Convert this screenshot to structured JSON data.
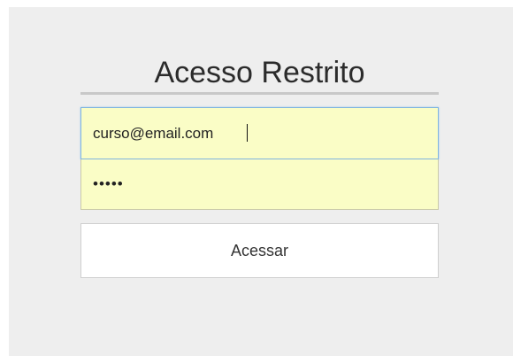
{
  "login": {
    "title": "Acesso Restrito",
    "email_value": "curso@email.com",
    "password_mask": "•••••",
    "submit_label": "Acessar"
  },
  "colors": {
    "panel_bg": "#eeeeee",
    "autofill_bg": "#fafdc6",
    "focus_border": "#7fb4e0"
  }
}
